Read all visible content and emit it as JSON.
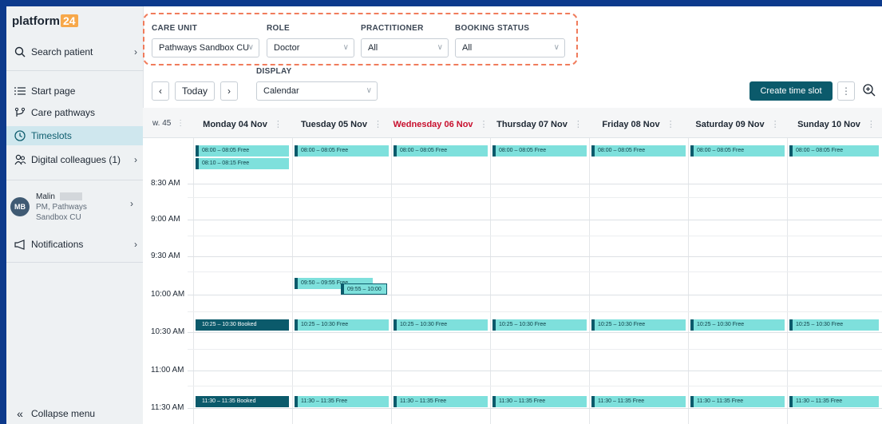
{
  "app": {
    "logo_text": "platform",
    "logo_num": "24"
  },
  "sidebar": {
    "search": "Search patient",
    "items": [
      {
        "label": "Start page",
        "icon": "list-icon"
      },
      {
        "label": "Care pathways",
        "icon": "pathway-icon"
      },
      {
        "label": "Timeslots",
        "icon": "clock-icon"
      },
      {
        "label": "Digital colleagues (1)",
        "icon": "people-icon"
      }
    ],
    "user": {
      "initials": "MB",
      "name": "Malin",
      "role": "PM, Pathways Sandbox CU"
    },
    "notifications": "Notifications",
    "collapse": "Collapse menu"
  },
  "filters": {
    "care_unit": {
      "label": "CARE UNIT",
      "value": "Pathways Sandbox CU"
    },
    "role": {
      "label": "ROLE",
      "value": "Doctor"
    },
    "practitioner": {
      "label": "PRACTITIONER",
      "value": "All"
    },
    "booking_status": {
      "label": "BOOKING STATUS",
      "value": "All"
    }
  },
  "toolbar": {
    "today": "Today",
    "display_label": "DISPLAY",
    "display_value": "Calendar",
    "create": "Create time slot"
  },
  "calendar": {
    "week": "w. 45",
    "days": [
      {
        "label": "Monday 04 Nov"
      },
      {
        "label": "Tuesday 05 Nov"
      },
      {
        "label": "Wednesday 06 Nov"
      },
      {
        "label": "Thursday 07 Nov"
      },
      {
        "label": "Friday 08 Nov"
      },
      {
        "label": "Saturday 09 Nov"
      },
      {
        "label": "Sunday 10 Nov"
      }
    ],
    "times": [
      "8:30 AM",
      "9:00 AM",
      "9:30 AM",
      "10:00 AM",
      "10:30 AM",
      "11:00 AM",
      "11:30 AM"
    ],
    "slots": {
      "s0800": "08:00 – 08:05 Free",
      "s0810": "08:10 – 08:15 Free",
      "s0950": "09:50 – 09:55 Free",
      "s0955": "09:55 – 10:00",
      "s1025b": "10:25 – 10:30 Booked",
      "s1025f": "10:25 – 10:30 Free",
      "s1130b": "11:30 – 11:35 Booked",
      "s1130f": "11:30 – 11:35 Free"
    }
  },
  "colors": {
    "accent": "#0b5a6b",
    "slot_free": "#7ee0dc",
    "today": "#c8102e",
    "frame": "#0d3a8c"
  }
}
